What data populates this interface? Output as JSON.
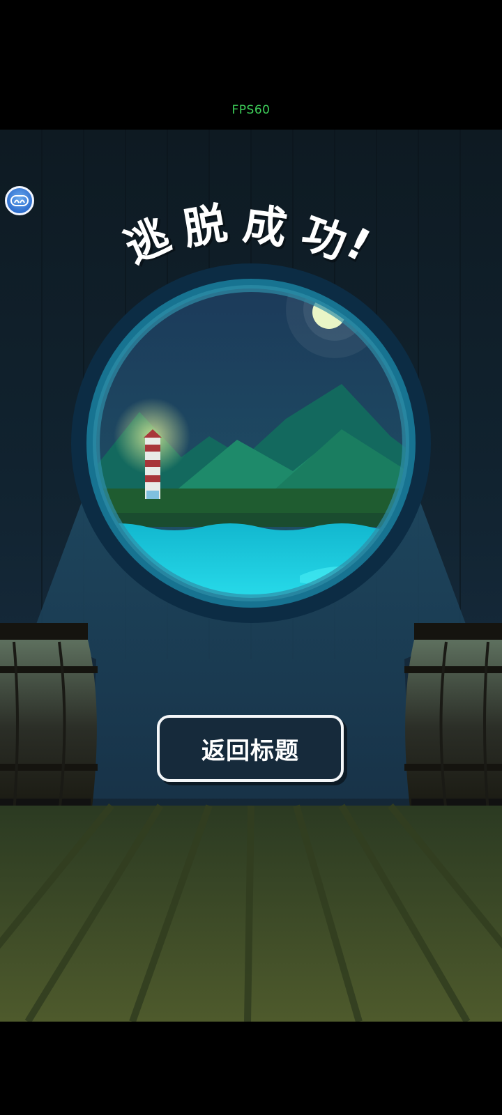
{
  "status": {
    "fps_text": "FPS60"
  },
  "overlay": {
    "float_ball_icon": "face-icon",
    "float_ball_color": "#3b7fdb"
  },
  "result": {
    "title_chars": [
      "逃",
      "脱",
      "成",
      "功",
      "!"
    ],
    "title": "逃脱成功!"
  },
  "actions": {
    "return_label": "返回标题"
  },
  "colors": {
    "water": "#1ed3e6",
    "mountains": "#1e8a6a",
    "porthole_ring": "#176f8a",
    "deck": "#4d5a30"
  }
}
